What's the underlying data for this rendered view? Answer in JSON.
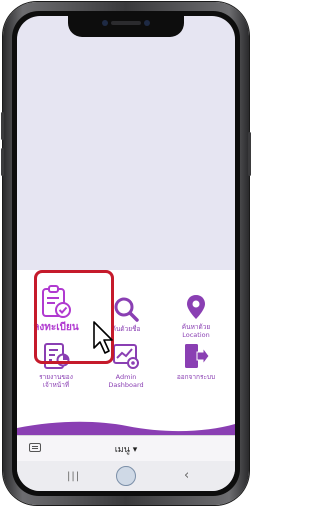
{
  "menu": {
    "items": [
      {
        "label": "ลงทะเบียน",
        "icon": "register-clipboard-icon"
      },
      {
        "label": "ค้นด้วยชื่อ",
        "icon": "search-icon"
      },
      {
        "label": "ค้นหาด้วย\nLocation",
        "icon": "location-pin-icon"
      },
      {
        "label": "รายงานของ\nเจ้าหน้าที่",
        "icon": "staff-report-icon"
      },
      {
        "label": "Admin\nDashboard",
        "icon": "admin-dashboard-icon"
      },
      {
        "label": "ออกจากระบบ",
        "icon": "logout-icon"
      }
    ]
  },
  "bottom_bar": {
    "menu_select": "เมนู ▾",
    "keyboard_icon": "keyboard-icon"
  },
  "navbar": {
    "recents": "|||",
    "back": "‹",
    "home_icon": "home-icon"
  },
  "colors": {
    "accent": "#8a3fb3",
    "highlight": "#c51a2b",
    "screen_bg": "#e6e5f2"
  }
}
